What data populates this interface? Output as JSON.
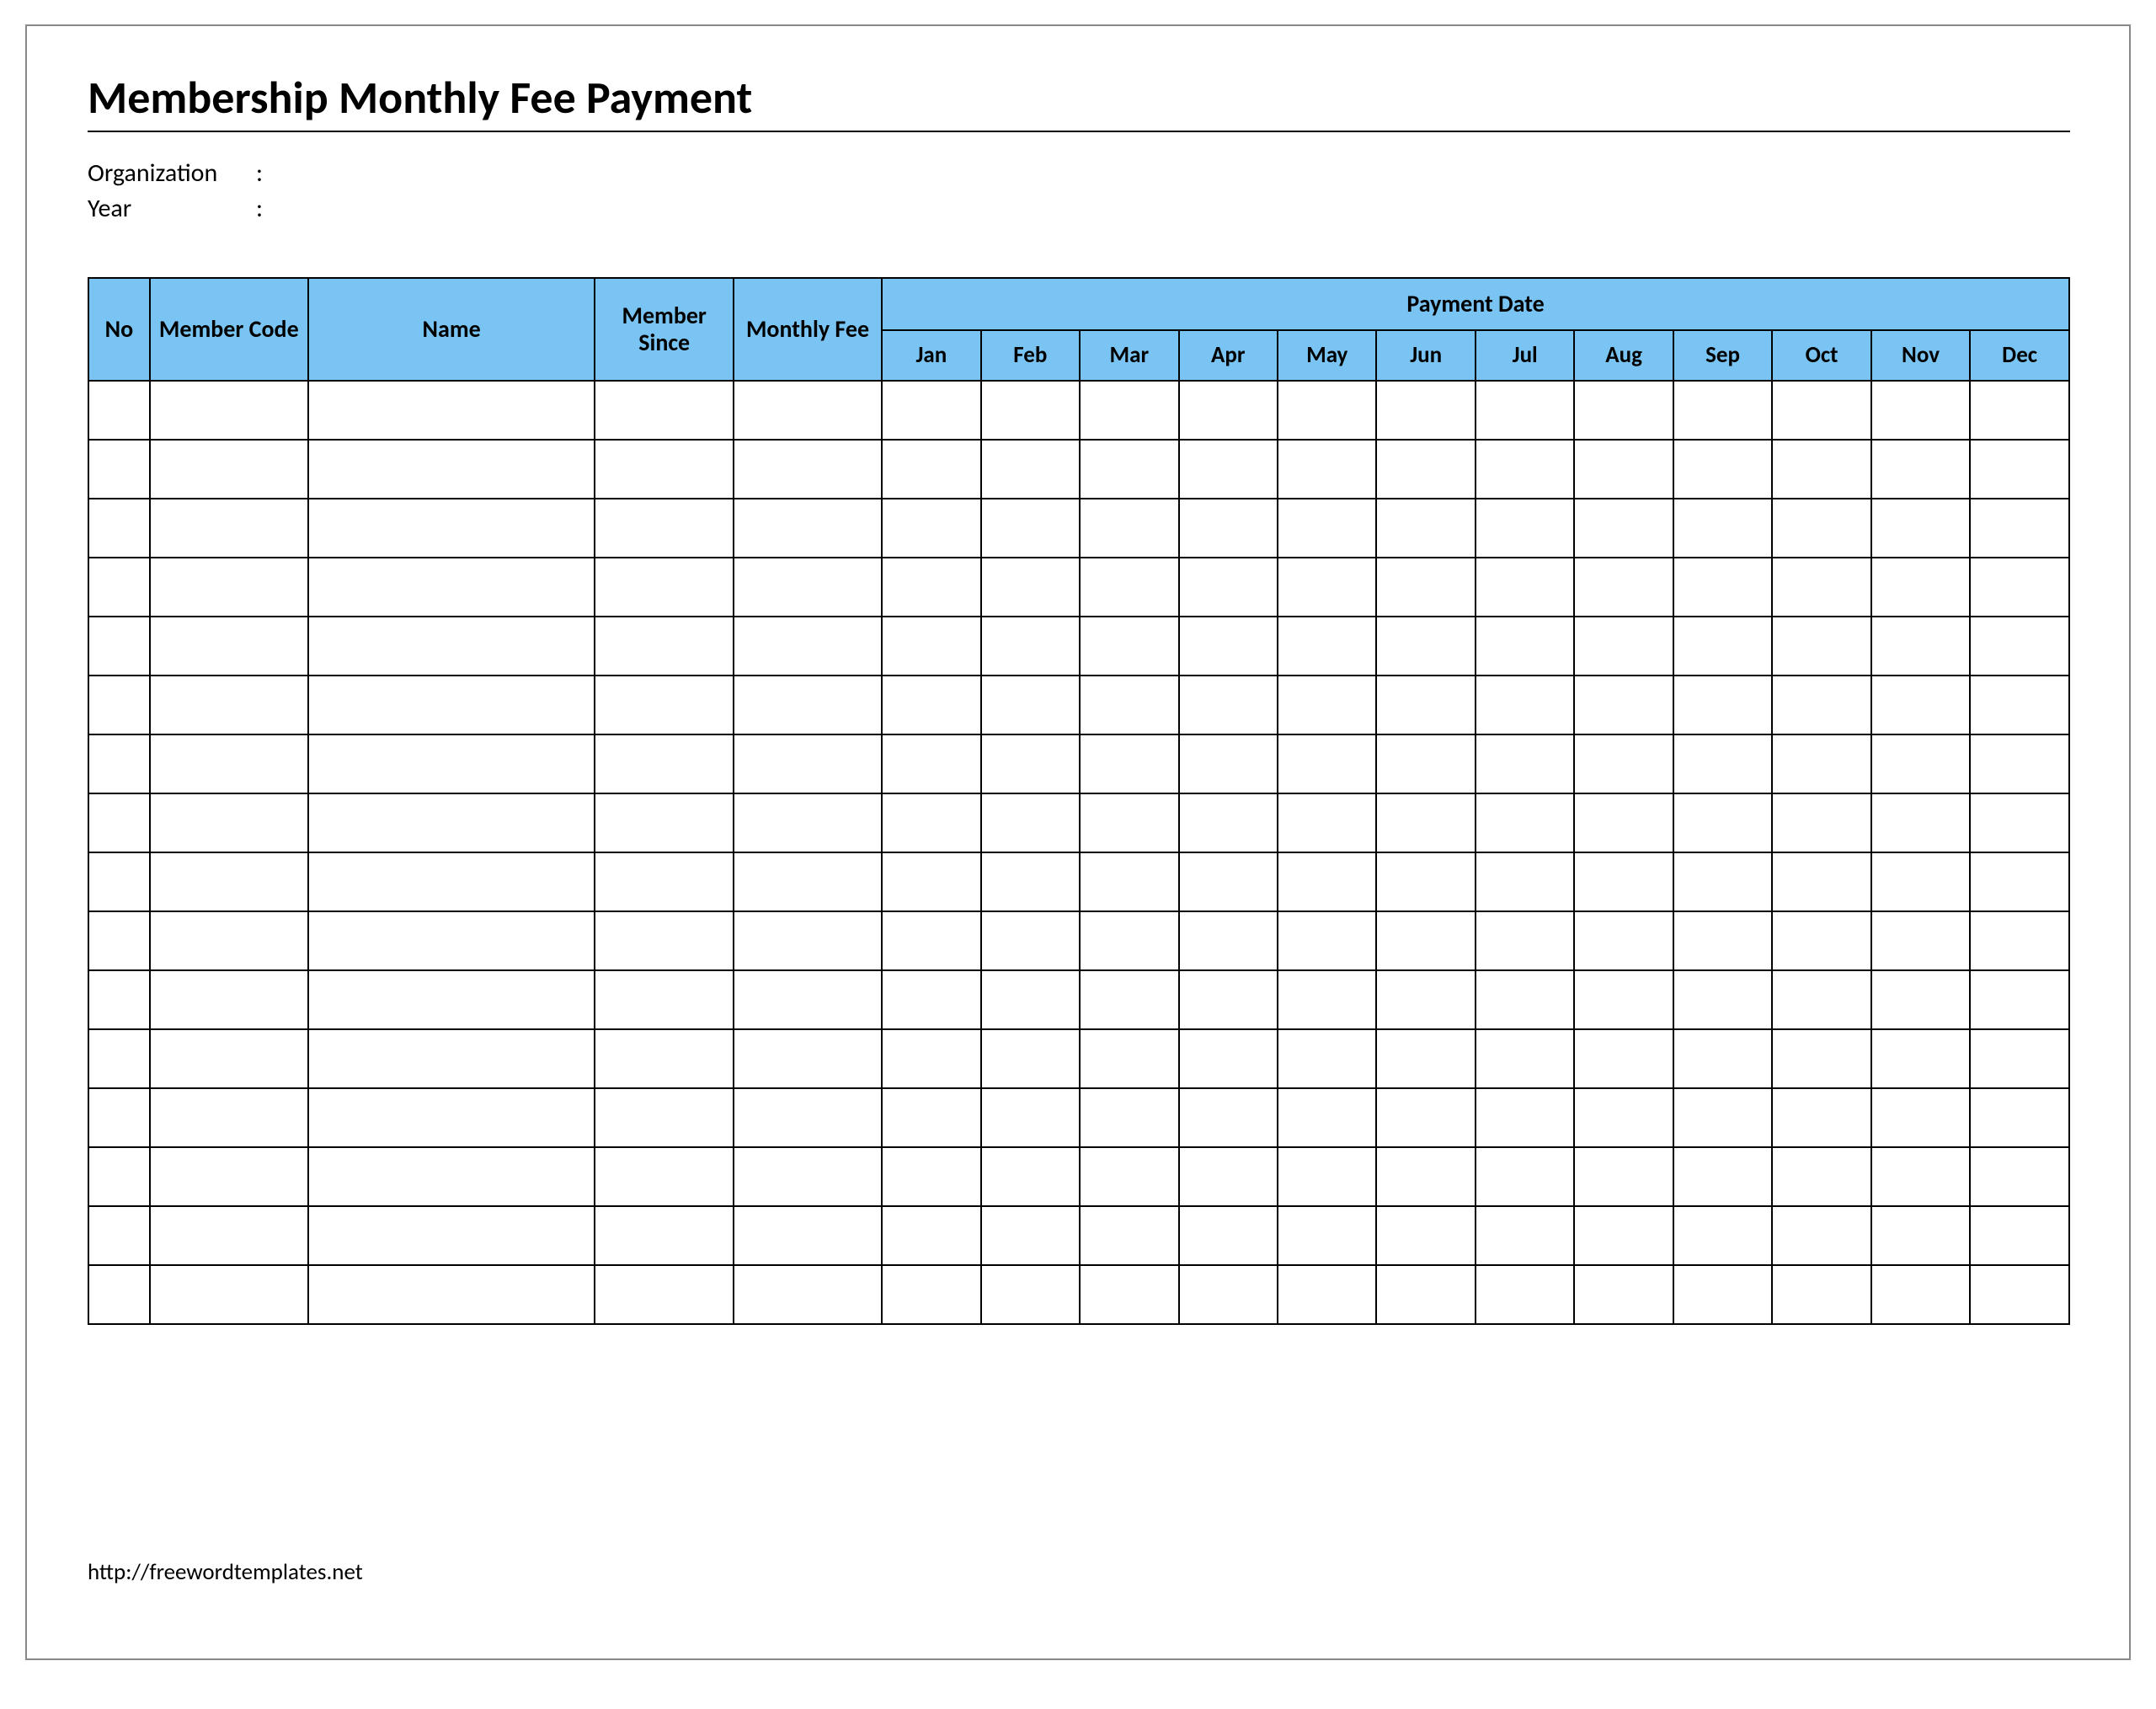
{
  "title": "Membership Monthly Fee Payment",
  "meta": {
    "organization_label": "Organization",
    "year_label": "Year",
    "colon": ":"
  },
  "table": {
    "headers": {
      "no": "No",
      "member_code": "Member Code",
      "name": "Name",
      "member_since": "Member Since",
      "monthly_fee": "Monthly Fee",
      "payment_date": "Payment Date"
    },
    "months": [
      "Jan",
      "Feb",
      "Mar",
      "Apr",
      "May",
      "Jun",
      "Jul",
      "Aug",
      "Sep",
      "Oct",
      "Nov",
      "Dec"
    ],
    "row_count": 16
  },
  "footer_url": "http://freewordtemplates.net"
}
